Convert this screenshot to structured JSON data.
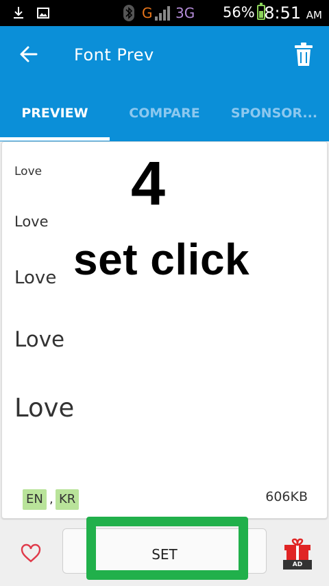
{
  "status_bar": {
    "signal_g": "G",
    "signal_3g": "3G",
    "battery_percent": "56%",
    "time": "8:51",
    "ampm": "AM",
    "icons": [
      "download-icon",
      "image-icon",
      "bluetooth-icon",
      "signal-icon",
      "battery-icon"
    ]
  },
  "app_bar": {
    "title": "Font Prev",
    "back_icon": "arrow-left-icon",
    "delete_icon": "trash-icon",
    "color": "#0b8fd8"
  },
  "tabs": [
    {
      "label": "PREVIEW",
      "active": true
    },
    {
      "label": "COMPARE",
      "active": false
    },
    {
      "label": "SPONSOR...",
      "active": false
    }
  ],
  "preview": {
    "samples": [
      "Love",
      "Love",
      "Love",
      "Love",
      "Love"
    ],
    "overlay_number": "4",
    "overlay_text": "set click",
    "languages": [
      "EN",
      "KR"
    ],
    "separator": ",",
    "file_size": "606KB"
  },
  "bottom_bar": {
    "favorite_icon": "heart-icon",
    "set_label": "SET",
    "gift_icon": "gift-icon",
    "ad_label": "AD",
    "highlight_color": "#21b04b"
  }
}
